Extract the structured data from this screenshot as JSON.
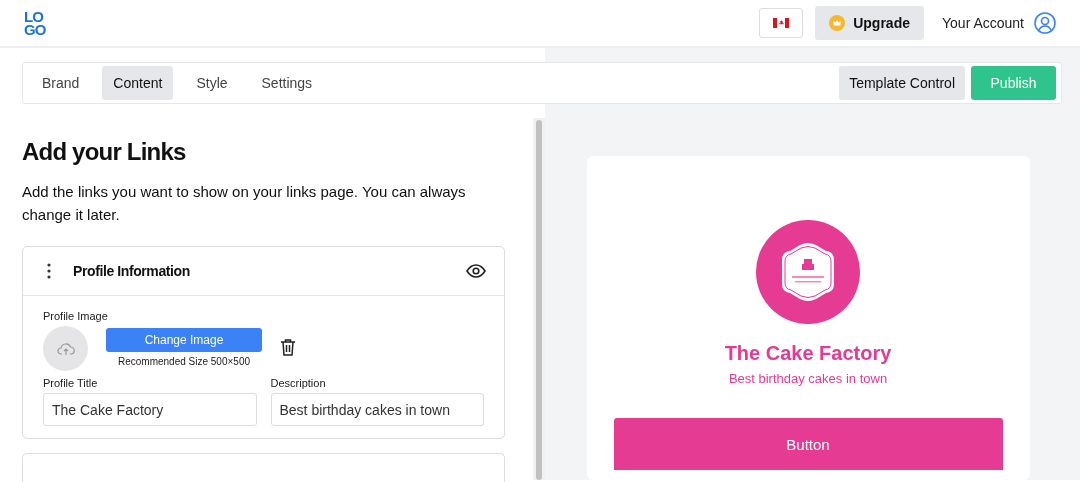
{
  "header": {
    "logo": [
      "LO",
      "GO"
    ],
    "language_button": {
      "kind": "flag"
    },
    "upgrade_button": "Upgrade",
    "account_link": "Your Account"
  },
  "tabs": [
    {
      "label": "Brand",
      "selected": false
    },
    {
      "label": "Content",
      "selected": true
    },
    {
      "label": "Style",
      "selected": false
    },
    {
      "label": "Settings",
      "selected": false
    }
  ],
  "toolbar_buttons": [
    {
      "label": "Template Control",
      "kind": "secondary"
    },
    {
      "label": "Publish",
      "kind": "primary"
    }
  ],
  "editor": {
    "title": "Add your Links",
    "intro": "Add the links you want to show on your links page. You can always change it later.",
    "profile_card": {
      "title": "Profile Information",
      "image_label": "Profile Image",
      "change_button": "Change Image",
      "size_hint": "Recommended Size 500×500",
      "fields": [
        {
          "label": "Profile Title",
          "value": "The Cake Factory"
        },
        {
          "label": "Description",
          "value": "Best birthday cakes in town"
        }
      ]
    }
  },
  "preview": {
    "name": "The Cake Factory",
    "tagline": "Best birthday cakes in town",
    "button": "Button"
  }
}
